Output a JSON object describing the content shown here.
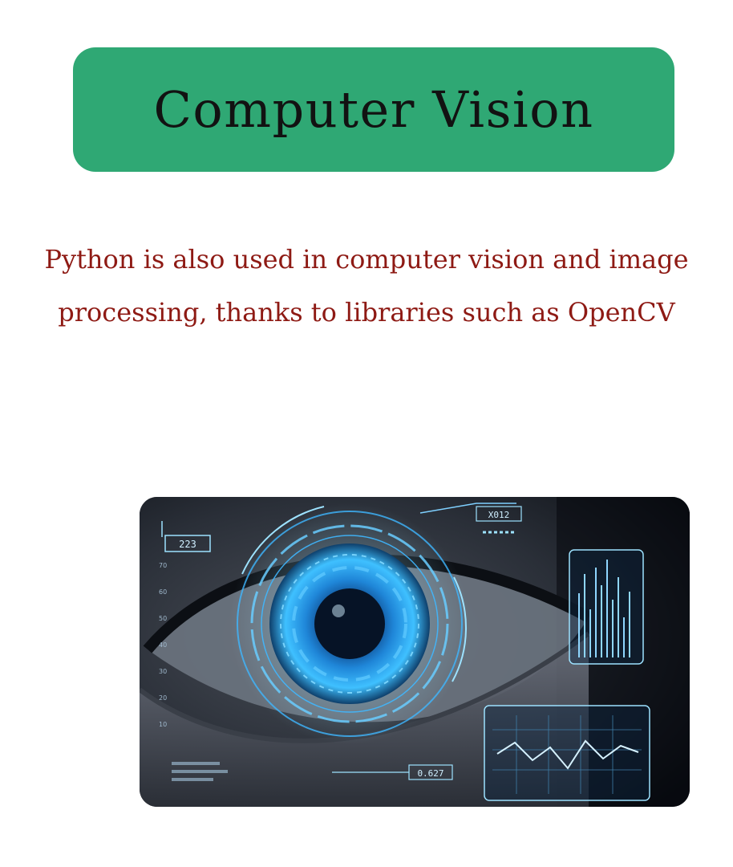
{
  "title": "Computer Vision",
  "description": "Python is also used in computer vision and image processing, thanks to libraries such as OpenCV",
  "image": {
    "hud_label_top_left": "223",
    "hud_label_top_right": "X012",
    "hud_label_bottom": "0.627",
    "scale_ticks": [
      "70",
      "60",
      "50",
      "40",
      "30",
      "20",
      "10"
    ]
  },
  "colors": {
    "banner": "#2fa874",
    "title_text": "#121212",
    "description_text": "#8e1a14",
    "hud_blue": "#3fb7ff"
  }
}
